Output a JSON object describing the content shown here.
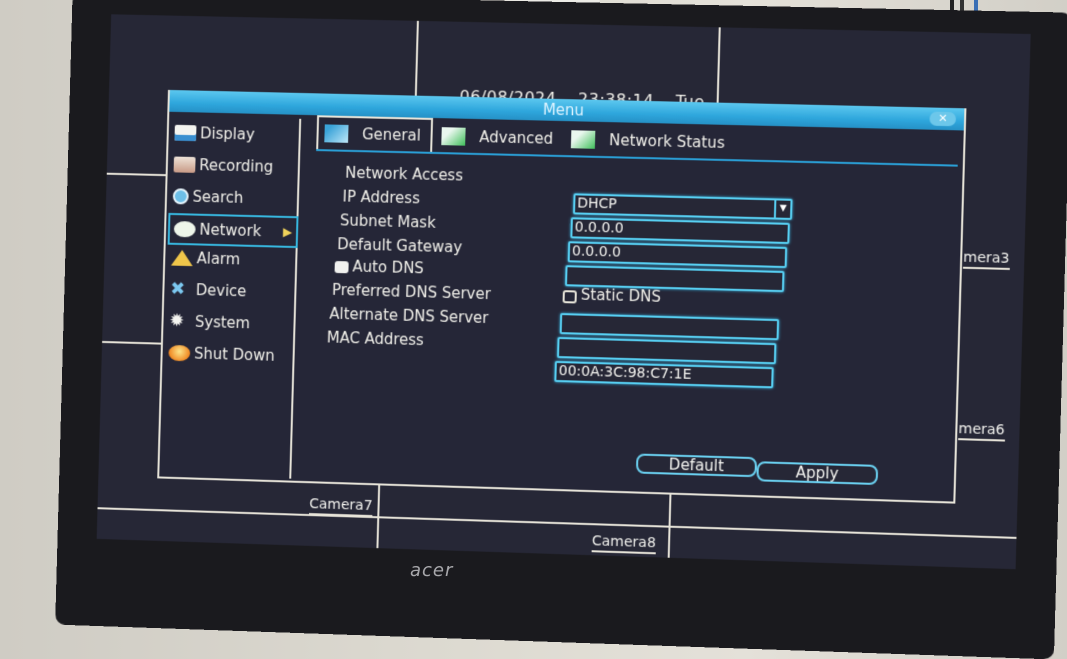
{
  "monitor": {
    "brand": "acer"
  },
  "osd": {
    "date": "06/08/2024",
    "time": "23:38:14",
    "weekday": "Tue",
    "camera_labels": [
      "mera3",
      "mera6",
      "Camera7",
      "Camera8"
    ]
  },
  "menu": {
    "title": "Menu",
    "close_icon": "close-icon",
    "sidebar": {
      "items": [
        {
          "label": "Display",
          "icon": "display-icon",
          "active": false
        },
        {
          "label": "Recording",
          "icon": "recording-icon",
          "active": false
        },
        {
          "label": "Search",
          "icon": "search-icon",
          "active": false
        },
        {
          "label": "Network",
          "icon": "network-icon",
          "active": true
        },
        {
          "label": "Alarm",
          "icon": "alarm-icon",
          "active": false
        },
        {
          "label": "Device",
          "icon": "device-icon",
          "active": false
        },
        {
          "label": "System",
          "icon": "system-icon",
          "active": false
        },
        {
          "label": "Shut Down",
          "icon": "shutdown-icon",
          "active": false
        }
      ]
    },
    "tabs": [
      {
        "label": "General",
        "active": true
      },
      {
        "label": "Advanced",
        "active": false
      },
      {
        "label": "Network Status",
        "active": false
      }
    ],
    "form": {
      "network_access": {
        "label": "Network Access",
        "value": "DHCP"
      },
      "ip_address": {
        "label": "IP Address",
        "value": "0.0.0.0"
      },
      "subnet_mask": {
        "label": "Subnet Mask",
        "value": "0.0.0.0"
      },
      "default_gateway": {
        "label": "Default Gateway",
        "value": ""
      },
      "auto_dns": {
        "label": "Auto DNS",
        "checked": true
      },
      "static_dns": {
        "label": "Static DNS",
        "checked": false
      },
      "preferred_dns": {
        "label": "Preferred DNS Server",
        "value": ""
      },
      "alternate_dns": {
        "label": "Alternate DNS Server",
        "value": ""
      },
      "mac_address": {
        "label": "MAC Address",
        "value": "00:0A:3C:98:C7:1E"
      }
    },
    "buttons": {
      "default": "Default",
      "apply": "Apply"
    }
  },
  "colors": {
    "accent": "#2ea6dc",
    "field_border": "#57cff2",
    "background": "#252637"
  }
}
